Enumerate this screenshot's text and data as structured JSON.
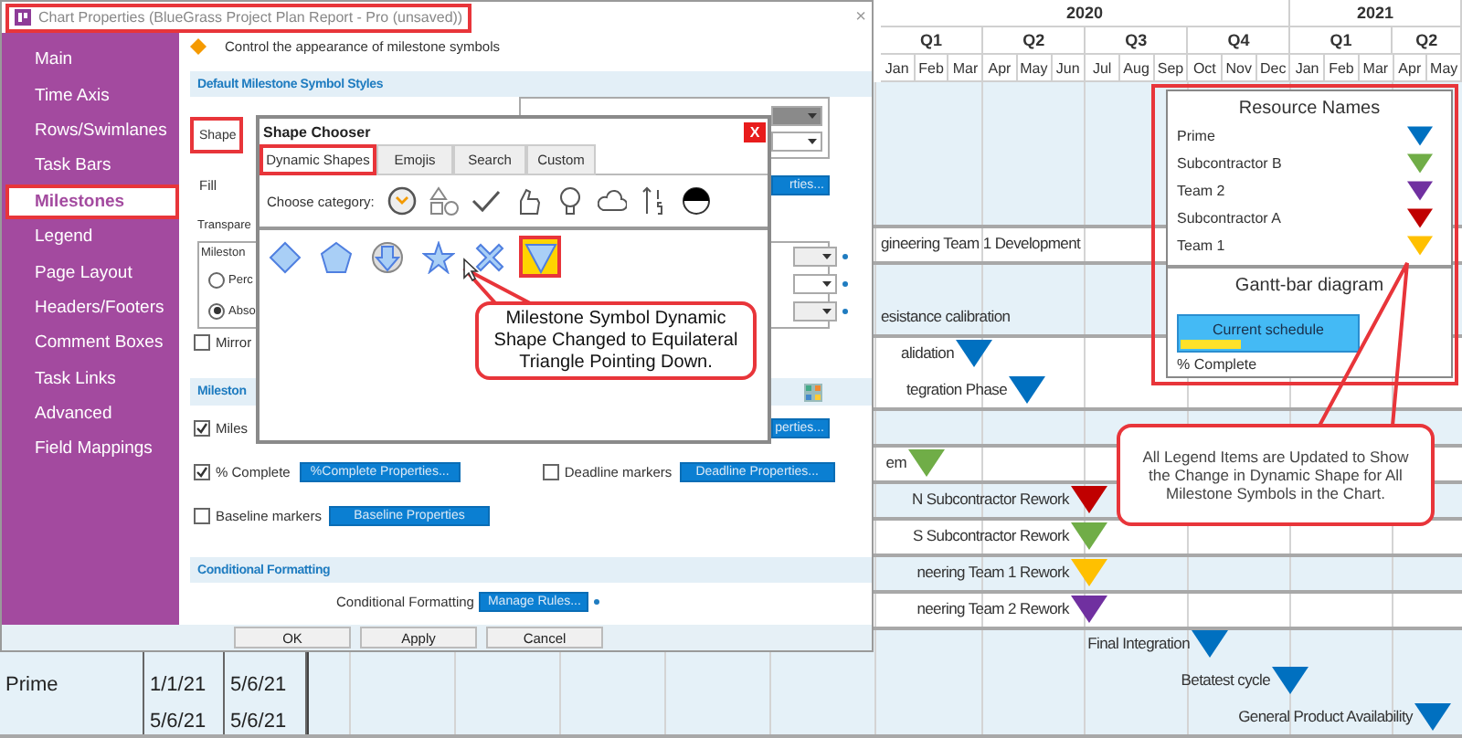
{
  "chart": {
    "years": [
      {
        "label": "2020"
      },
      {
        "label": "2021"
      }
    ],
    "quarters": [
      {
        "label": "Q1"
      },
      {
        "label": "Q2"
      },
      {
        "label": "Q3"
      },
      {
        "label": "Q4"
      },
      {
        "label": "Q1"
      },
      {
        "label": "Q2"
      }
    ],
    "months": [
      "Jan",
      "Feb",
      "Mar",
      "Apr",
      "May",
      "Jun",
      "Jul",
      "Aug",
      "Sep",
      "Oct",
      "Nov",
      "Dec",
      "Jan",
      "Feb",
      "Mar",
      "Apr",
      "May"
    ],
    "rows": [
      {
        "shaded": true
      },
      {
        "shaded": false,
        "lines": [
          {
            "label": "gineering Team 1 Development"
          }
        ]
      },
      {
        "shaded": true,
        "lines": [
          {
            "label": "esistance calibration"
          }
        ]
      },
      {
        "shaded": false,
        "lines": [
          {
            "label": "alidation",
            "color": "#0070c0"
          },
          {
            "label": "tegration Phase",
            "color": "#0070c0"
          }
        ]
      },
      {
        "shaded": true
      },
      {
        "shaded": false,
        "lines": [
          {
            "label": "em",
            "color": "#70ad47"
          }
        ]
      },
      {
        "shaded": true,
        "lines": [
          {
            "label": "N Subcontractor Rework",
            "color": "#c00000"
          }
        ]
      },
      {
        "shaded": false,
        "lines": [
          {
            "label": "S Subcontractor Rework",
            "color": "#70ad47"
          }
        ]
      },
      {
        "shaded": true,
        "lines": [
          {
            "label": "neering Team 1 Rework",
            "color": "#ffc000"
          }
        ]
      },
      {
        "shaded": false,
        "lines": [
          {
            "label": "neering Team 2 Rework",
            "color": "#7030a0"
          }
        ]
      },
      {
        "shaded": true,
        "resource": "Prime",
        "starts": [
          "1/1/21",
          "5/6/21"
        ],
        "ends": [
          "5/6/21",
          "5/6/21"
        ],
        "lines": [
          {
            "label": "Final Integration",
            "color": "#0070c0"
          },
          {
            "label": "Betatest cycle",
            "color": "#0070c0"
          },
          {
            "label": "General Product Availability",
            "color": "#0070c0"
          }
        ]
      }
    ]
  },
  "legend": {
    "title": "Resource Names",
    "items": [
      {
        "label": "Prime",
        "color": "#0070c0"
      },
      {
        "label": "Subcontractor B",
        "color": "#70ad47"
      },
      {
        "label": "Team 2",
        "color": "#7030a0"
      },
      {
        "label": "Subcontractor A",
        "color": "#c00000"
      },
      {
        "label": "Team 1",
        "color": "#ffc000"
      }
    ],
    "bar_title": "Gantt-bar diagram",
    "bar_label": "Current schedule",
    "progress": {
      "level": 0.34
    },
    "progress_label": "% Complete"
  },
  "legend_callout": "All Legend Items are Updated to Show the Change in Dynamic Shape for All Milestone Symbols in the Chart.",
  "dialog": {
    "title": "Chart Properties (BlueGrass Project Plan Report - Pro (unsaved))",
    "close": "×",
    "nav": [
      {
        "label": "Main",
        "selected": false
      },
      {
        "label": "Time Axis",
        "selected": false
      },
      {
        "label": "Rows/Swimlanes",
        "selected": false
      },
      {
        "label": "Task Bars",
        "selected": false
      },
      {
        "label": "Milestones",
        "selected": true
      },
      {
        "label": "Legend",
        "selected": false
      },
      {
        "label": "Page Layout",
        "selected": false
      },
      {
        "label": "Headers/Footers",
        "selected": false
      },
      {
        "label": "Comment Boxes",
        "selected": false
      },
      {
        "label": "Task Links",
        "selected": false
      },
      {
        "label": "Advanced",
        "selected": false
      },
      {
        "label": "Field Mappings",
        "selected": false
      }
    ],
    "description": "Control the appearance of milestone symbols",
    "symbol_styles": {
      "heading": "Default Milestone Symbol Styles",
      "shape_label": "Shape",
      "fill_label": "Fill",
      "fill_button": "rties...",
      "transparency_label": "Transpare",
      "group_legend": "Mileston",
      "radios": [
        {
          "label": "Perc",
          "selected": false
        },
        {
          "label": "Abso",
          "selected": true
        }
      ],
      "mirror": {
        "label": "Mirror",
        "checked": false
      }
    },
    "elements": {
      "heading": "Mileston",
      "items": [
        {
          "label": "Miles",
          "checked": true,
          "button": "perties..."
        },
        {
          "label": "% Complete",
          "checked": true,
          "button": "%Complete Properties..."
        },
        {
          "label": "Deadline markers",
          "checked": false,
          "button": "Deadline Properties..."
        },
        {
          "label": "Baseline markers",
          "checked": false,
          "button": "Baseline Properties"
        }
      ]
    },
    "conditional": {
      "heading": "Conditional Formatting",
      "label": "Conditional Formatting",
      "button": "Manage Rules..."
    },
    "buttons": [
      "OK",
      "Apply",
      "Cancel"
    ]
  },
  "shape_chooser": {
    "title": "Shape Chooser",
    "close": "X",
    "tabs": [
      {
        "label": "Dynamic Shapes",
        "selected": true
      },
      {
        "label": "Emojis",
        "selected": false
      },
      {
        "label": "Search",
        "selected": false
      },
      {
        "label": "Custom",
        "selected": false
      }
    ],
    "category_label": "Choose category:",
    "shapes": [
      {
        "kind": "diamond",
        "selected": false
      },
      {
        "kind": "pentagon",
        "selected": false
      },
      {
        "kind": "arrow",
        "selected": false
      },
      {
        "kind": "star",
        "selected": false
      },
      {
        "kind": "cross",
        "selected": false
      },
      {
        "kind": "triangle",
        "selected": true
      }
    ],
    "callout": "Milestone Symbol Dynamic Shape Changed to Equilateral Triangle Pointing Down."
  }
}
